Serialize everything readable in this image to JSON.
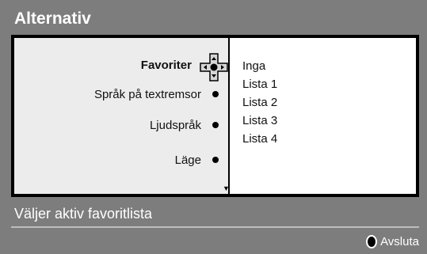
{
  "header": {
    "title": "Alternativ"
  },
  "menu": {
    "items": [
      {
        "label": "Favoriter",
        "active": true
      },
      {
        "label": "Språk på textremsor",
        "active": false
      },
      {
        "label": "Ljudspråk",
        "active": false
      },
      {
        "label": "Läge",
        "active": false
      }
    ],
    "nav_icon": "dpad-icon",
    "scroll_icon": "scroll-down-arrow-icon"
  },
  "options": {
    "items": [
      "Inga",
      "Lista 1",
      "Lista 2",
      "Lista 3",
      "Lista 4"
    ]
  },
  "status": {
    "text": "Väljer aktiv favoritlista"
  },
  "footer": {
    "exit_label": "Avsluta",
    "exit_icon": "remote-button-icon"
  },
  "colors": {
    "background": "#7d7d7d",
    "panel_border": "#000000",
    "left_pane": "#ececec",
    "right_pane": "#ffffff",
    "text_light": "#ffffff"
  }
}
